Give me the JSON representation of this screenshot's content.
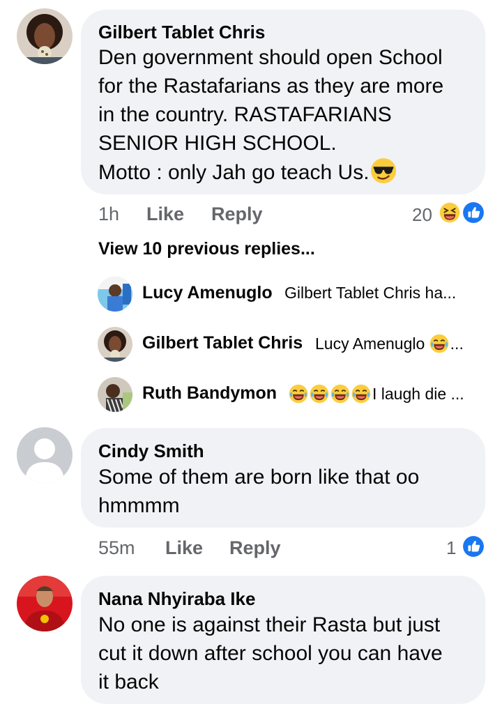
{
  "comments": [
    {
      "author": "Gilbert Tablet Chris",
      "lines": [
        "Den government should open School",
        "for the Rastafarians as they are more",
        "in the country. RASTAFARIANS",
        "SENIOR HIGH SCHOOL.",
        "Motto : only Jah go teach Us."
      ],
      "emoji_icon": "sunglasses-face-icon",
      "time": "1h",
      "like_label": "Like",
      "reply_label": "Reply",
      "reaction_count": "20",
      "reactions": [
        "haha-icon",
        "like-icon"
      ]
    },
    {
      "author": "Cindy Smith",
      "lines": [
        "Some of them are born like that oo",
        "hmmmm"
      ],
      "time": "55m",
      "like_label": "Like",
      "reply_label": "Reply",
      "reaction_count": "1",
      "reactions": [
        "like-icon"
      ]
    },
    {
      "author": "Nana Nhyiraba Ike",
      "lines": [
        "No one is against their Rasta but just",
        "cut it down after school you can have",
        "it back"
      ]
    }
  ],
  "view_previous": "View 10 previous replies...",
  "replies": [
    {
      "author": "Lucy Amenuglo",
      "preview": "Gilbert Tablet Chris ha..."
    },
    {
      "author": "Gilbert Tablet Chris",
      "preview_prefix": "Lucy Amenuglo",
      "preview_suffix": "...",
      "emoji_icon": "tears-of-joy-icon"
    },
    {
      "author": "Ruth Bandymon",
      "preview": "I laugh die ...",
      "emoji_icon": "tears-of-joy-icon",
      "emoji_count": 4
    }
  ],
  "colors": {
    "bubble": "#f0f2f5",
    "meta_text": "#65676b",
    "like_blue": "#1877f2",
    "emoji_yellow": "#fbcd3e"
  }
}
